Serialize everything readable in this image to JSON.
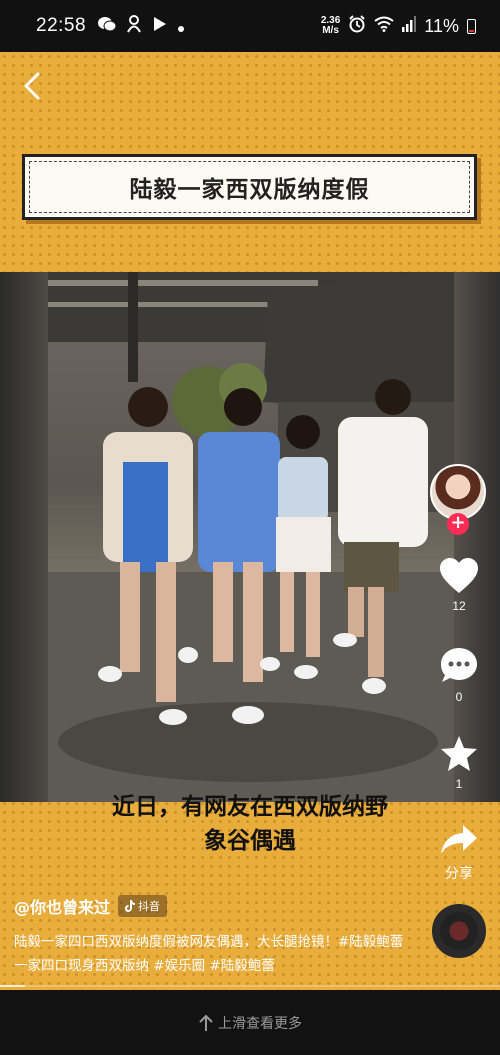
{
  "status_bar": {
    "time": "22:58",
    "net_speed_value": "2.36",
    "net_speed_unit": "M/s",
    "battery": "11%",
    "icons": [
      "wechat-icon",
      "app-icon",
      "play-store-icon",
      "dot-icon",
      "alarm-icon",
      "wifi-icon",
      "signal-icon",
      "battery-icon"
    ]
  },
  "header": {
    "back_icon": "chevron-left-icon",
    "banner_title": "陆毅一家西双版纳度假"
  },
  "video": {
    "subtitle_line1": "近日，有网友在西双版纳野",
    "subtitle_line2": "象谷偶遇"
  },
  "actions": {
    "like_count": "12",
    "comment_count": "0",
    "favorite_count": "1",
    "share_label": "分享",
    "follow_symbol": "+"
  },
  "post": {
    "author": "@你也曾来过",
    "platform": "抖音",
    "description": "陆毅一家四口西双版纳度假被网友偶遇，大长腿抢镜！#陆毅鲍蕾一家四口现身西双版纳 #娱乐圈 #陆毅鲍蕾"
  },
  "progress": 0.05,
  "bottom": {
    "swipe_hint": "上滑查看更多"
  },
  "colors": {
    "background_yellow": "#e9ad3c",
    "follow_red": "#fe2c55"
  }
}
